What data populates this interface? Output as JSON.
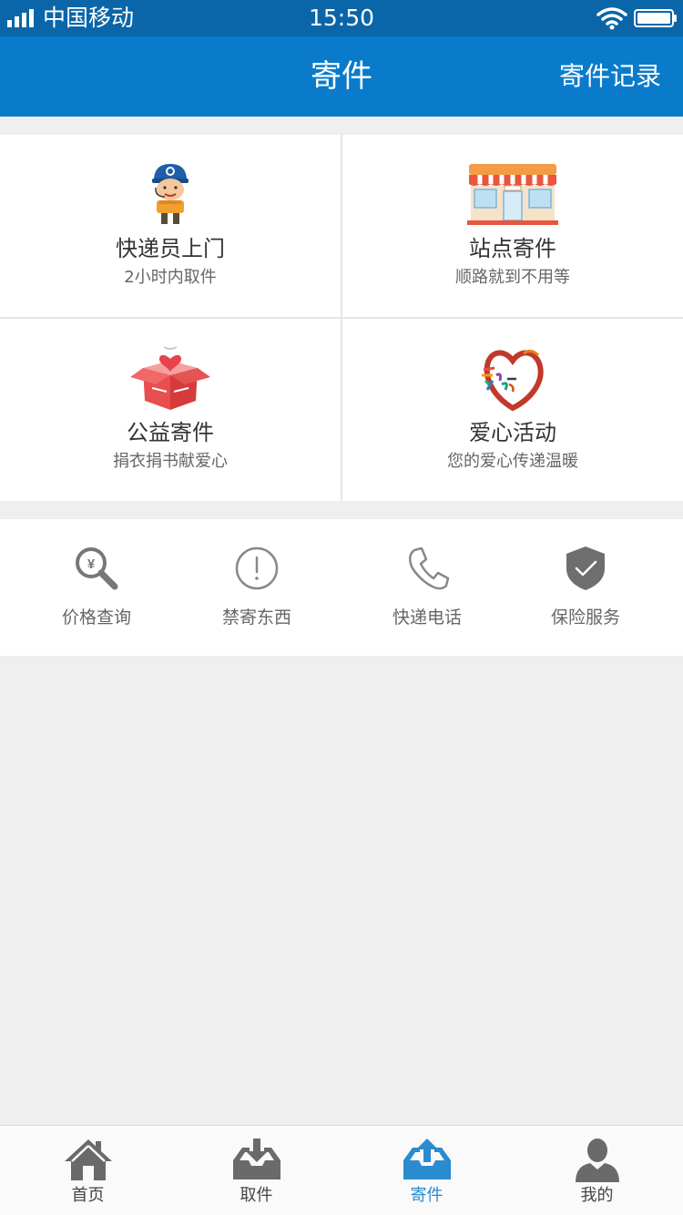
{
  "status_bar": {
    "carrier": "中国移动",
    "time": "15:50",
    "icons": [
      "signal-icon",
      "wifi-icon",
      "battery-icon"
    ]
  },
  "nav": {
    "title": "寄件",
    "record_label": "寄件记录"
  },
  "services": [
    {
      "title": "快递员上门",
      "subtitle": "2小时内取件",
      "icon": "courier-icon"
    },
    {
      "title": "站点寄件",
      "subtitle": "顺路就到不用等",
      "icon": "store-icon"
    },
    {
      "title": "公益寄件",
      "subtitle": "捐衣捐书献爱心",
      "icon": "gift-box-icon"
    },
    {
      "title": "爱心活动",
      "subtitle": "您的爱心传递温暖",
      "icon": "love-heart-icon"
    }
  ],
  "tools": [
    {
      "label": "价格查询",
      "icon": "price-search-icon"
    },
    {
      "label": "禁寄东西",
      "icon": "warning-icon"
    },
    {
      "label": "快递电话",
      "icon": "phone-icon"
    },
    {
      "label": "保险服务",
      "icon": "shield-check-icon"
    }
  ],
  "tabs": [
    {
      "label": "首页",
      "icon": "home-icon"
    },
    {
      "label": "取件",
      "icon": "inbox-download-icon"
    },
    {
      "label": "寄件",
      "icon": "inbox-upload-icon",
      "active": true
    },
    {
      "label": "我的",
      "icon": "user-icon"
    }
  ],
  "colors": {
    "status_bar": "#0a66a8",
    "nav_bar": "#0a7bcb",
    "active_tab": "#2a8bd0",
    "background": "#efefef"
  }
}
